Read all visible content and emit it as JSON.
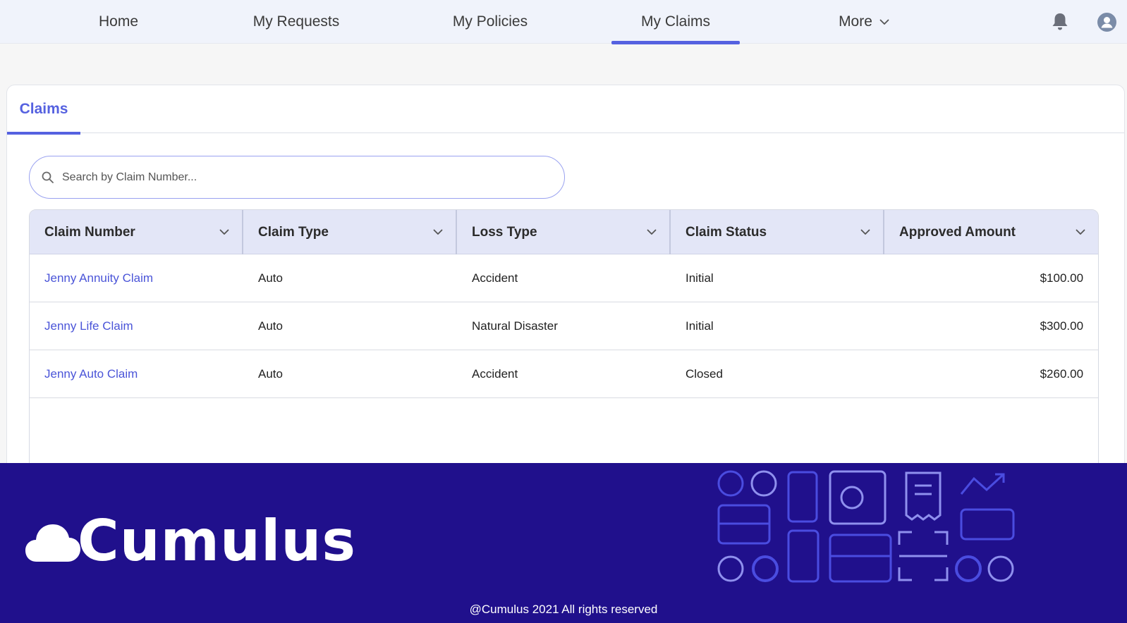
{
  "nav": {
    "items": [
      {
        "label": "Home"
      },
      {
        "label": "My Requests"
      },
      {
        "label": "My Policies"
      },
      {
        "label": "My Claims"
      },
      {
        "label": "More"
      }
    ],
    "active": "My Claims"
  },
  "icons": {
    "notifications": "bell-icon",
    "profile": "user-avatar-icon",
    "search": "search-icon",
    "sort": "chevron-down-icon"
  },
  "card": {
    "tab_label": "Claims"
  },
  "search": {
    "placeholder": "Search by Claim Number...",
    "value": ""
  },
  "table": {
    "columns": [
      "Claim Number",
      "Claim Type",
      "Loss Type",
      "Claim Status",
      "Approved Amount"
    ],
    "rows": [
      {
        "claim_number": "Jenny Annuity Claim",
        "claim_type": "Auto",
        "loss_type": "Accident",
        "claim_status": "Initial",
        "approved_amount": "$100.00"
      },
      {
        "claim_number": "Jenny Life Claim",
        "claim_type": "Auto",
        "loss_type": "Natural Disaster",
        "claim_status": "Initial",
        "approved_amount": "$300.00"
      },
      {
        "claim_number": "Jenny Auto Claim",
        "claim_type": "Auto",
        "loss_type": "Accident",
        "claim_status": "Closed",
        "approved_amount": "$260.00"
      }
    ]
  },
  "footer": {
    "brand": "Cumulus",
    "copyright": "@Cumulus 2021 All rights reserved"
  },
  "colors": {
    "accent": "#5561e0",
    "link": "#4a54d8",
    "header_row": "#e3e6f7",
    "footer_bg": "#20108c"
  }
}
